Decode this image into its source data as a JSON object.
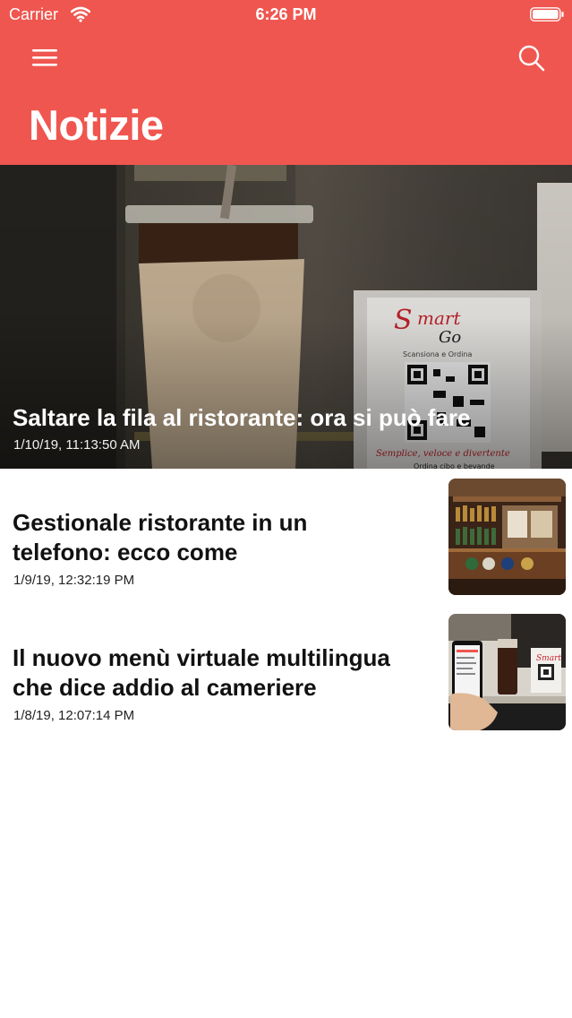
{
  "status_bar": {
    "carrier": "Carrier",
    "time": "6:26 PM",
    "icons": [
      "wifi-icon",
      "battery-icon"
    ]
  },
  "header": {
    "menu_icon": "hamburger-menu-icon",
    "search_icon": "search-icon",
    "title": "Notizie",
    "background_color": "#ef564f"
  },
  "featured": {
    "title": "Saltare la fila al ristorante: ora si può fare",
    "date": "1/10/19, 11:13:50 AM",
    "image": {
      "sign_logo": "Smart Go",
      "sign_tagline": "Scansiona e Ordina",
      "sign_footer": "Semplice, veloce e divertente",
      "sign_footer2": "Ordina cibo e bevande"
    }
  },
  "articles": [
    {
      "title_line1": "Gestionale ristorante in un",
      "title_line2": "telefono: ecco come",
      "date": "1/9/19, 12:32:19 PM",
      "thumbnail": "bar-counter-photo"
    },
    {
      "title_line1": "Il nuovo menù virtuale multilingua",
      "title_line2": "che dice addio al cameriere",
      "date": "1/8/19, 12:07:14 PM",
      "thumbnail": "phone-scanning-qr-photo"
    }
  ]
}
